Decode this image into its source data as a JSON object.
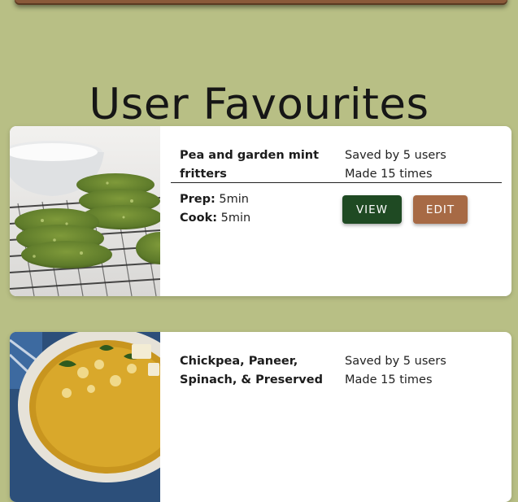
{
  "page": {
    "title": "User Favourites"
  },
  "colors": {
    "background": "#b8bf85",
    "view_button": "#1f4a23",
    "edit_button": "#a76a45",
    "header_bar": "#8a5a3a"
  },
  "recipes": [
    {
      "name": "Pea and garden mint fritters",
      "saved": "Saved by 5 users",
      "made": "Made 15 times",
      "prep_label": "Prep:",
      "prep": "5min",
      "cook_label": "Cook:",
      "cook": "5min",
      "view_label": "VIEW",
      "edit_label": "EDIT"
    },
    {
      "name": "Chickpea, Paneer, Spinach, & Preserved",
      "saved": "Saved by 5 users",
      "made": "Made 15 times"
    }
  ]
}
